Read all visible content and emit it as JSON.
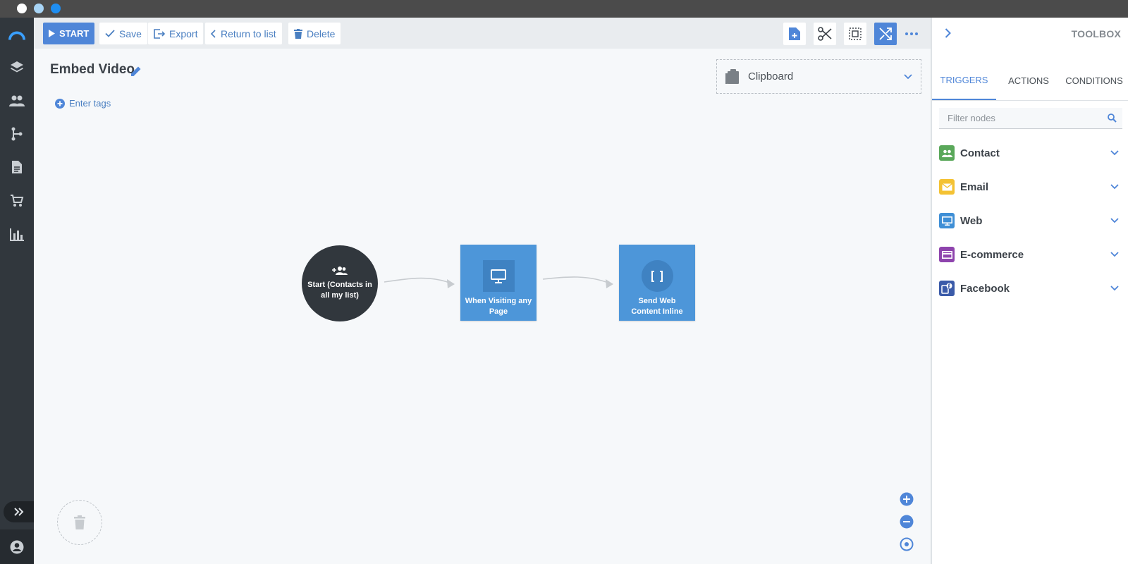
{
  "colors": {
    "accent": "#4f86d8",
    "rail": "#31373d",
    "node_blue": "#4d96d9",
    "contact": "#5aa85a",
    "email": "#f4c233",
    "web": "#3f8fd6",
    "ecommerce": "#8e44ad",
    "facebook": "#3b5ba9"
  },
  "toolbar": {
    "start_label": "START",
    "save_label": "Save",
    "export_label": "Export",
    "return_label": "Return to list",
    "delete_label": "Delete"
  },
  "canvas": {
    "title": "Embed Video",
    "tags_label": "Enter tags",
    "clipboard_label": "Clipboard",
    "nodes": [
      {
        "label": "Start (Contacts in all my list)",
        "icon": "group-add-icon"
      },
      {
        "label": "When Visiting any Page",
        "icon": "monitor-icon"
      },
      {
        "label": "Send Web Content Inline",
        "icon": "brackets-icon"
      }
    ]
  },
  "toolbox": {
    "title": "TOOLBOX",
    "tabs": [
      {
        "label": "TRIGGERS",
        "active": true
      },
      {
        "label": "ACTIONS",
        "active": false
      },
      {
        "label": "CONDITIONS",
        "active": false
      }
    ],
    "filter_placeholder": "Filter nodes",
    "categories": [
      {
        "label": "Contact",
        "icon": "people-icon"
      },
      {
        "label": "Email",
        "icon": "envelope-icon"
      },
      {
        "label": "Web",
        "icon": "monitor-icon"
      },
      {
        "label": "E-commerce",
        "icon": "card-icon"
      },
      {
        "label": "Facebook",
        "icon": "facebook-icon"
      }
    ]
  }
}
